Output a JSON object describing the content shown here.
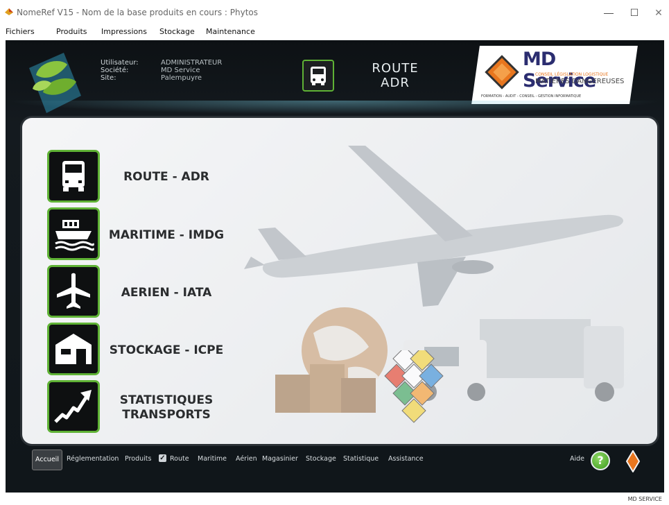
{
  "window": {
    "title": "NomeRef V15 - Nom de la base produits en cours : Phytos",
    "minimize": "—",
    "maximize": "☐",
    "close": "✕"
  },
  "menu": [
    "Fichiers",
    "Produits",
    "Impressions",
    "Stockage",
    "Maintenance"
  ],
  "header": {
    "labels": [
      "Utilisateur:",
      "Société:",
      "Site:"
    ],
    "values": [
      "ADMINISTRATEUR",
      "MD Service",
      "Palempuyre"
    ],
    "mode_line1": "ROUTE",
    "mode_line2": "ADR"
  },
  "logo": {
    "brand": "MD Service",
    "tagline1": "CONSEIL LÉGISLATION LOGISTIQUE",
    "tagline2": "MATIÈRES DANGEREUSES",
    "tagline3": "FORMATION - AUDIT - CONSEIL - GESTION INFORMATIQUE"
  },
  "modules": [
    {
      "label": "ROUTE - ADR",
      "icon": "truck-icon"
    },
    {
      "label": "MARITIME - IMDG",
      "icon": "ship-icon"
    },
    {
      "label": "AERIEN - IATA",
      "icon": "airplane-icon"
    },
    {
      "label": "STOCKAGE - ICPE",
      "icon": "warehouse-icon"
    },
    {
      "label": "STATISTIQUES",
      "label2": "TRANSPORTS",
      "icon": "chart-up-icon"
    }
  ],
  "toolbar": {
    "accueil": "Accueil",
    "items": [
      "Réglementation",
      "Produits",
      "Route",
      "Maritime",
      "Aérien",
      "Magasinier",
      "Stockage",
      "Statistique",
      "Assistance"
    ],
    "aide": "Aide",
    "help_icon": "?"
  },
  "footer": "MD SERVICE",
  "colors": {
    "accent": "#5fb235",
    "frame": "#10161a",
    "logo_orange": "#e8761e"
  }
}
